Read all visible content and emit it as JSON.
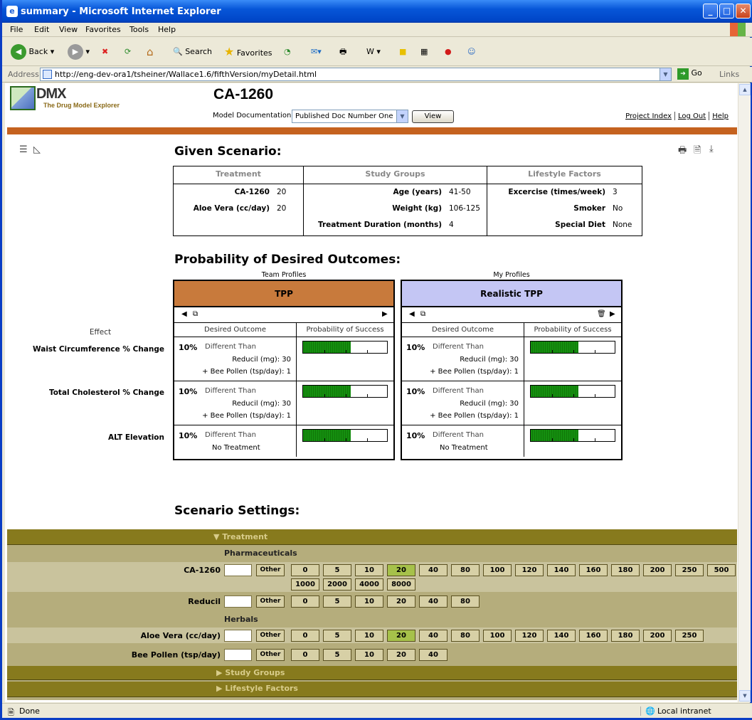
{
  "window": {
    "title": "summary - Microsoft Internet Explorer"
  },
  "menu": [
    "File",
    "Edit",
    "View",
    "Favorites",
    "Tools",
    "Help"
  ],
  "toolbar": {
    "back": "Back",
    "search": "Search",
    "favorites": "Favorites"
  },
  "address": {
    "label": "Address",
    "url": "http://eng-dev-ora1/tsheiner/Wallace1.6/fifthVersion/myDetail.html",
    "go": "Go",
    "links": "Links"
  },
  "status": {
    "left": "Done",
    "zone": "Local intranet"
  },
  "header": {
    "logo": "DMX",
    "logo_sub": "The Drug Model Explorer",
    "title": "CA-1260",
    "doc_label": "Model Documentation:",
    "doc_selected": "Published Doc Number One",
    "view_btn": "View",
    "links": [
      "Project Index",
      "Log Out",
      "Help"
    ]
  },
  "given": {
    "title": "Given Scenario:",
    "treatment_header": "Treatment",
    "treatment": [
      {
        "k": "CA-1260",
        "v": "20"
      },
      {
        "k": "Aloe Vera (cc/day)",
        "v": "20"
      }
    ],
    "study_header": "Study Groups",
    "study": [
      {
        "k": "Age (years)",
        "v": "41-50"
      },
      {
        "k": "Weight (kg)",
        "v": "106-125"
      },
      {
        "k": "Treatment Duration (months)",
        "v": "4"
      }
    ],
    "lifestyle_header": "Lifestyle Factors",
    "lifestyle": [
      {
        "k": "Excercise (times/week)",
        "v": "3"
      },
      {
        "k": "Smoker",
        "v": "No"
      },
      {
        "k": "Special Diet",
        "v": "None"
      }
    ]
  },
  "prob": {
    "title": "Probability of Desired Outcomes:",
    "effect_label": "Effect",
    "effects": [
      "Waist Circumference % Change",
      "Total Cholesterol % Change",
      "ALT Elevation"
    ],
    "col_outcome": "Desired Outcome",
    "col_success": "Probability of Success",
    "profiles": [
      {
        "group": "Team Profiles",
        "name": "TPP",
        "color": "#c87a3c",
        "rows": [
          {
            "pct": "10%",
            "dt": "Different Than",
            "l1": "Reducil (mg): 30",
            "l2": "+ Bee Pollen (tsp/day): 1",
            "fill": 0.57
          },
          {
            "pct": "10%",
            "dt": "Different Than",
            "l1": "Reducil (mg): 30",
            "l2": "+ Bee Pollen (tsp/day): 1",
            "fill": 0.57
          },
          {
            "pct": "10%",
            "dt": "Different Than",
            "l1": "No Treatment",
            "l2": "",
            "fill": 0.57
          }
        ]
      },
      {
        "group": "My Profiles",
        "name": "Realistic TPP",
        "color": "#c4c6f4",
        "rows": [
          {
            "pct": "10%",
            "dt": "Different Than",
            "l1": "Reducil (mg): 30",
            "l2": "+ Bee Pollen (tsp/day): 1",
            "fill": 0.57
          },
          {
            "pct": "10%",
            "dt": "Different Than",
            "l1": "Reducil (mg): 30",
            "l2": "+ Bee Pollen (tsp/day): 1",
            "fill": 0.57
          },
          {
            "pct": "10%",
            "dt": "Different Than",
            "l1": "No Treatment",
            "l2": "",
            "fill": 0.57
          }
        ]
      }
    ]
  },
  "settings": {
    "title": "Scenario Settings:",
    "treatment_bar": "Treatment",
    "pharma": "Pharmaceuticals",
    "herbals": "Herbals",
    "other": "Other",
    "rows": [
      {
        "label": "CA-1260",
        "values": [
          "0",
          "5",
          "10",
          "20",
          "40",
          "80",
          "100",
          "120",
          "140",
          "160",
          "180",
          "200",
          "250",
          "500",
          "1000",
          "2000",
          "4000",
          "8000"
        ],
        "selected": "20"
      },
      {
        "label": "Reducil",
        "values": [
          "0",
          "5",
          "10",
          "20",
          "40",
          "80"
        ],
        "selected": ""
      },
      {
        "label": "Aloe Vera (cc/day)",
        "values": [
          "0",
          "5",
          "10",
          "20",
          "40",
          "80",
          "100",
          "120",
          "140",
          "160",
          "180",
          "200",
          "250"
        ],
        "selected": "20"
      },
      {
        "label": "Bee Pollen (tsp/day)",
        "values": [
          "0",
          "5",
          "10",
          "20",
          "40"
        ],
        "selected": ""
      }
    ],
    "study_bar": "Study Groups",
    "lifestyle_bar": "Lifestyle Factors"
  }
}
